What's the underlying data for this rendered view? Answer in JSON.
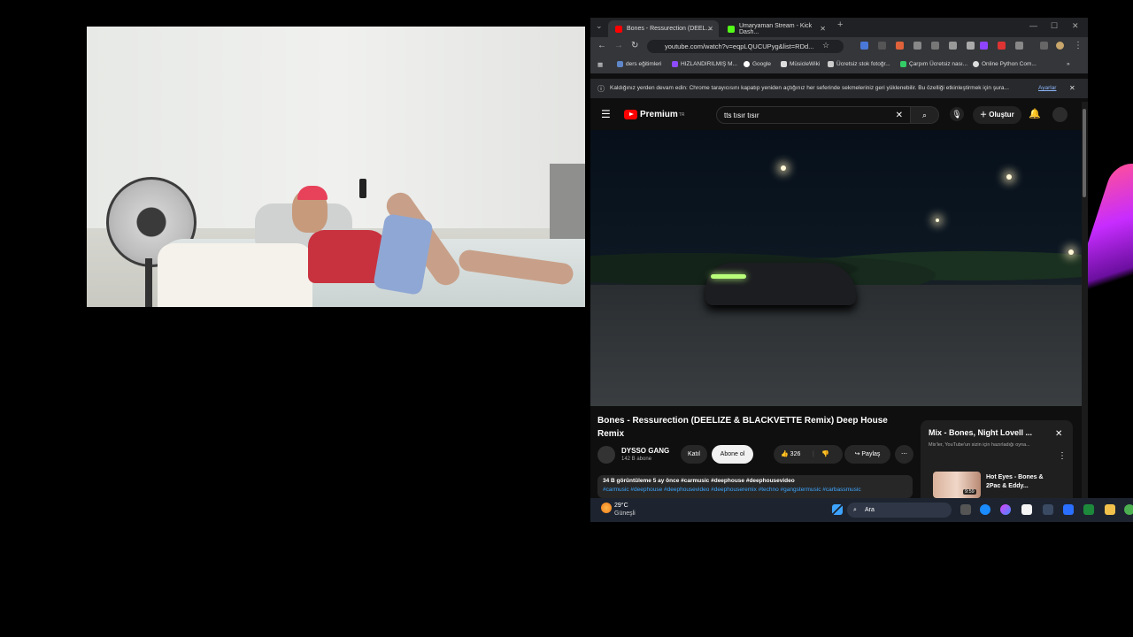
{
  "browser": {
    "tabs": [
      {
        "title": "Bones - Ressurection (DEEL...",
        "color": "#ff0000"
      },
      {
        "title": "Umaryaman Stream - Kick Dash...",
        "color": "#53fc18"
      }
    ],
    "new_tab": "+",
    "address": "youtube.com/watch?v=eqpLQUCUPyg&list=RDd...",
    "bookmarks": [
      {
        "label": "ders eğitimleri",
        "color": "#5f86c9"
      },
      {
        "label": "HIZLANDIRILMIŞ M...",
        "color": "#8d4cff"
      },
      {
        "label": "Google",
        "color": "#ffffff"
      },
      {
        "label": "MüsicleWiki",
        "color": "#dddddd"
      },
      {
        "label": "Ücretsiz stok fotoğr...",
        "color": "#cccccc"
      },
      {
        "label": "Çarpım Ücretsiz nası...",
        "color": "#33cc66"
      },
      {
        "label": "Online Python Com...",
        "color": "#dddddd"
      }
    ],
    "infobar": {
      "text": "Kaldığınız yerden devam edin: Chrome tarayıcısını kapatıp yeniden açtığınız her seferinde sekmeleriniz geri yüklenebilir. Bu özelliği etkinleştirmek için şura...",
      "link": "Ayarlar",
      "close": "✕"
    }
  },
  "youtube": {
    "logo_text": "Premium",
    "logo_sup": "TR",
    "search_value": "tts tısır tısır",
    "create_label": "Oluştur",
    "video": {
      "title": "Bones - Ressurection (DEELIZE & BLACKVETTE Remix) Deep House Remix",
      "channel": "DYSSO GANG",
      "subscribers": "142 B abone",
      "join_label": "Katıl",
      "subscribe_label": "Abone ol",
      "likes": "326",
      "share_label": "Paylaş",
      "desc_meta": "34 B görüntüleme  5 ay önce  #carmusic #deephouse #deephousevideo",
      "desc_tags": "#carmusic #deephouse #deephousevideo #deephouseremix #techno #gangstermusic #carbassmusic"
    },
    "mix": {
      "title": "Mix - Bones, Night Lovell ...",
      "subtitle": "Mix'ler, YouTube'un sizin için hazırladığı oyna...",
      "item_title": "Hot Eyes - Bones & 2Pac & Eddy...",
      "item_duration": "9:59"
    }
  },
  "taskbar": {
    "temp": "29°C",
    "condition": "Güneşli",
    "search_label": "Ara"
  }
}
